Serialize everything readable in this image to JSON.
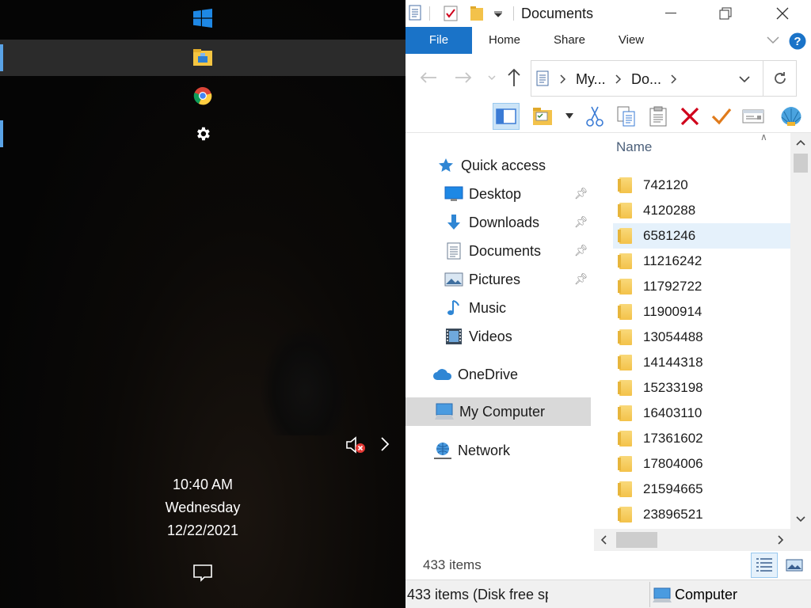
{
  "left": {
    "rail": [
      {
        "name": "start-button",
        "icon": "windows-logo-icon"
      },
      {
        "name": "file-explorer-app",
        "icon": "file-explorer-icon"
      },
      {
        "name": "chrome-app",
        "icon": "chrome-icon"
      },
      {
        "name": "settings-app",
        "icon": "gear-icon"
      }
    ],
    "clock": {
      "time": "10:40 AM",
      "day": "Wednesday",
      "date": "12/22/2021"
    },
    "notification_icons": [
      "volume-muted-icon",
      "chevron-right-icon"
    ]
  },
  "explorer": {
    "title": "Documents",
    "ribbon_tabs": [
      "File",
      "Home",
      "Share",
      "View"
    ],
    "address": {
      "crumb1": "My...",
      "crumb2": "Do..."
    },
    "nav": {
      "quick_access": "Quick access",
      "items": [
        "Desktop",
        "Downloads",
        "Documents",
        "Pictures",
        "Music",
        "Videos"
      ],
      "onedrive": "OneDrive",
      "my_computer": "My Computer",
      "network": "Network"
    },
    "column_header": "Name",
    "files": [
      "742120",
      "4120288",
      "6581246",
      "11216242",
      "11792722",
      "11900914",
      "13054488",
      "14144318",
      "15233198",
      "16403110",
      "17361602",
      "17804006",
      "21594665",
      "23896521"
    ],
    "status": {
      "item_count": "433 items",
      "disk": "433 items (Disk free sp",
      "computer": "Computer"
    },
    "colors": {
      "accent": "#1a73c8",
      "folder": "#f3c24a",
      "delete": "#d0021b",
      "check": "#e07b1c"
    }
  }
}
